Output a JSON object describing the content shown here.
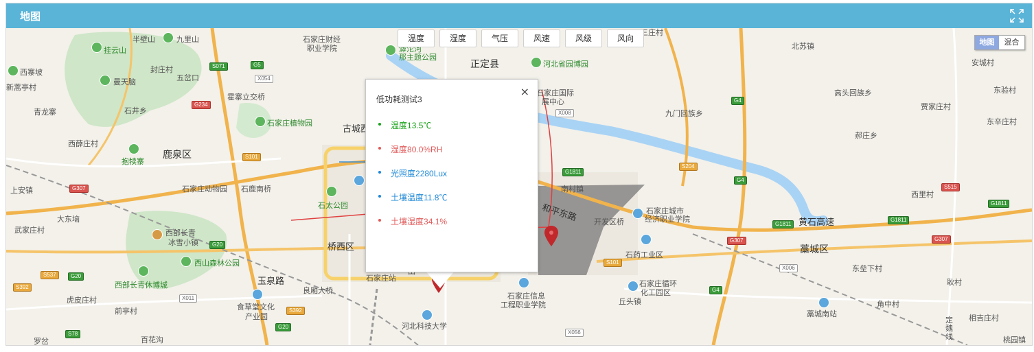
{
  "header": {
    "title": "地图"
  },
  "filters": [
    "温度",
    "湿度",
    "气压",
    "风速",
    "风级",
    "风向"
  ],
  "map_type": {
    "map": "地图",
    "hybrid": "混合"
  },
  "popup": {
    "title": "低功耗测试3",
    "close": "×",
    "readings": [
      {
        "label": "温度",
        "value": "13.5℃",
        "color": "#1aa31a"
      },
      {
        "label": "湿度",
        "value": "80.0%RH",
        "color": "#e05a5a"
      },
      {
        "label": "光照度",
        "value": "2280Lux",
        "color": "#1e88d6"
      },
      {
        "label": "土壤温度",
        "value": "11.8℃",
        "color": "#1e88d6"
      },
      {
        "label": "土壤湿度",
        "value": "34.1%",
        "color": "#e05a5a"
      }
    ]
  },
  "map_labels": {
    "l1": "半壁山",
    "l2": "九里山",
    "l3": "挂云山",
    "l4": "西寨坡",
    "l5": "新蒿亭村",
    "l6": "封庄村",
    "l7": "五岔口",
    "l8": "曼天脑",
    "l9": "霍寨立交桥",
    "l10": "青龙寨",
    "l11": "石井乡",
    "l12": "石家庄植物园",
    "l13": "古城西",
    "l14": "西薛庄村",
    "l15": "鹿泉区",
    "l16": "抱犊寨",
    "l17": "上安镇",
    "l18": "石家庄动物园",
    "l19": "石鹿南桥",
    "l20": "大东垴",
    "l21": "武家庄村",
    "l22": "西部长青",
    "l23": "冰雪小镇",
    "l24": "西山森林公园",
    "l25": "西部长青休博城",
    "l26": "虎皮庄村",
    "l27": "前亭村",
    "l28": "玉泉路",
    "l29": "良厢大桥",
    "l30": "食草堂文化",
    "l31": "产业园",
    "l32": "罗岔",
    "l33": "百花沟",
    "l34": "桥西区",
    "l35": "石太公园",
    "l36": "石家庄财经",
    "l37": "职业学院",
    "l38": "滹沱河",
    "l39": "那主题公园",
    "l40": "正定县",
    "l41": "河北省园博园",
    "l42": "石家庄国际",
    "l43": "展中心",
    "l44": "九门回族乡",
    "l45": "高头回族乡",
    "l46": "贾家庄村",
    "l47": "北苏镇",
    "l48": "安城村",
    "l49": "东验村",
    "l50": "东辛庄村",
    "l51": "郝庄乡",
    "l52": "西里村",
    "l53": "南村镇",
    "l54": "和平东路",
    "l55": "开发区桥",
    "l56": "石家庄城市",
    "l57": "经济职业学院",
    "l58": "黄石高速",
    "l59": "石药工业区",
    "l60": "藁城区",
    "l61": "东垒下村",
    "l62": "耿村",
    "l63": "石家庄循环",
    "l64": "化工园区",
    "l65": "丘头镇",
    "l66": "石家庄信息",
    "l67": "工程职业学院",
    "l68": "河北科技大学",
    "l69": "石家庄站",
    "l70": "藁城南站",
    "l71": "角中村",
    "l72": "相吉庄村",
    "l73": "定魏线",
    "l74": "桃园镇",
    "l75": "三庄村",
    "l76": "田"
  },
  "shields": {
    "s1": "S071",
    "s2": "G5",
    "s3": "X054",
    "s4": "G234",
    "s5": "S101",
    "s6": "G307",
    "s7": "G20",
    "s8": "S537",
    "s9": "G20",
    "s10": "S392",
    "s11": "X011",
    "s12": "S392",
    "s13": "G20",
    "s14": "S78",
    "s15": "X008",
    "s16": "G1811",
    "s17": "G4",
    "s18": "S204",
    "s19": "G4",
    "s20": "S101",
    "s21": "G1811",
    "s22": "G307",
    "s23": "X006",
    "s24": "G4",
    "s25": "G1811",
    "s26": "G307",
    "s27": "S515",
    "s28": "G1811",
    "s29": "X056"
  }
}
